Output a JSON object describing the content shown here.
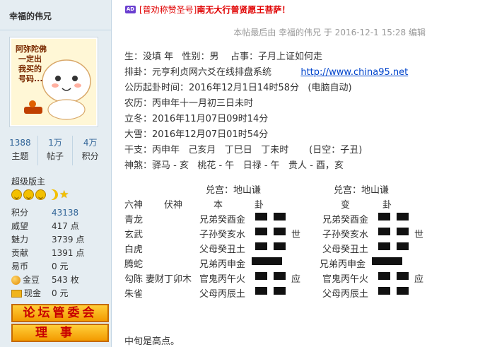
{
  "sidebar": {
    "username": "幸福的伟兄",
    "stats": [
      {
        "value": "1388",
        "label": "主题"
      },
      {
        "value": "1万",
        "label": "帖子"
      },
      {
        "value": "4万",
        "label": "积分"
      }
    ],
    "rank": "超级版主",
    "attributes": [
      {
        "label": "积分",
        "value": "43138",
        "link": true
      },
      {
        "label": "威望",
        "value": "417 点"
      },
      {
        "label": "魅力",
        "value": "3739 点"
      },
      {
        "label": "贡献",
        "value": "1391 点"
      },
      {
        "label": "易币",
        "value": "0 元"
      },
      {
        "label": "金豆",
        "value": "543 枚",
        "icon": "coin-icon"
      },
      {
        "label": "现金",
        "value": "0 元",
        "icon": "cash-icon"
      }
    ],
    "badges": [
      "论坛管委会",
      "理事"
    ],
    "avatar_text": [
      "阿弥陀佛",
      "一定出",
      "我买的",
      "号码..."
    ]
  },
  "post": {
    "ad_icon": "AD",
    "ad_text": "[普劝称赞圣号]",
    "ad_text2": "南无大行普贤愿王菩萨！",
    "edited": "本帖最后由 幸福的伟兄 于 2016-12-1 15:28 编辑",
    "lines": [
      "生：没填 年   性别：男    占事：子月上证如何走",
      "公历起卦时间：2016年12月1日14时58分   (电脑自动)",
      "农历：丙申年十一月初三日未时",
      "立冬：2016年11月07日09时14分",
      "大雪：2016年12月07日01时54分",
      "干支：丙申年   己亥月   丁巳日   丁未时       (日空：子丑)",
      "神煞：驿马 - 亥   桃花 - 午   日禄 - 午   贵人 - 酉，亥"
    ],
    "paigua_label": "排卦：元亨利贞网六爻在线排盘系统",
    "paigua_link": "http://www.china95.net",
    "hex": {
      "title_left": "兑宫：地山谦",
      "title_right": "兑宫：地山谦",
      "h_liushen": "六神",
      "h_fushen": "伏神",
      "h_ben": "本",
      "h_gua": "卦",
      "h_bian": "变",
      "h_gua2": "卦",
      "rows": [
        {
          "shen": "青龙",
          "fu": "",
          "ben": "兄弟癸酉金",
          "bian": "兄弟癸酉金",
          "mark": "",
          "mark2": ""
        },
        {
          "shen": "玄武",
          "fu": "",
          "ben": "子孙癸亥水",
          "bian": "子孙癸亥水",
          "mark": "世",
          "mark2": "世"
        },
        {
          "shen": "白虎",
          "fu": "",
          "ben": "父母癸丑土",
          "bian": "父母癸丑土",
          "mark": "",
          "mark2": ""
        },
        {
          "shen": "腾蛇",
          "fu": "",
          "ben": "兄弟丙申金",
          "bian": "兄弟丙申金",
          "mark": "",
          "mark2": ""
        },
        {
          "shen": "勾陈",
          "fu": "妻财丁卯木",
          "ben": "官鬼丙午火",
          "bian": "官鬼丙午火",
          "mark": "应",
          "mark2": "应"
        },
        {
          "shen": "朱雀",
          "fu": "",
          "ben": "父母丙辰土",
          "bian": "父母丙辰土",
          "mark": "",
          "mark2": ""
        }
      ],
      "yao_ben": [
        "yin",
        "yin",
        "yin",
        "yang",
        "yin",
        "yin"
      ],
      "yao_bian": [
        "yin",
        "yin",
        "yin",
        "yang",
        "yin",
        "yin"
      ]
    },
    "footer": "中旬是高点。"
  }
}
